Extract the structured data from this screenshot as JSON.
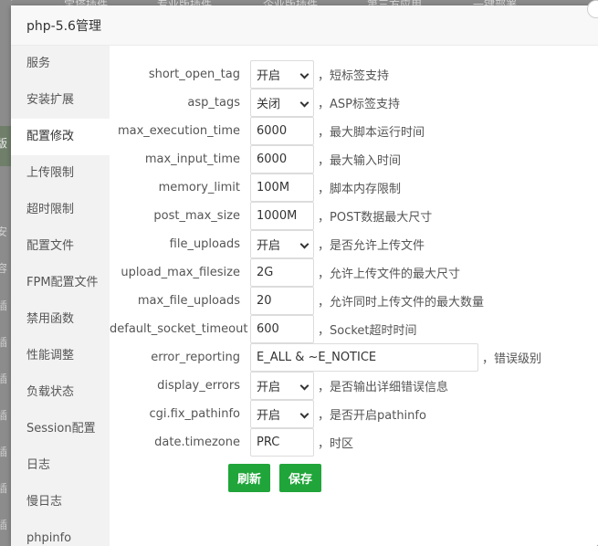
{
  "background": {
    "top_tabs": [
      "页",
      "宝塔插件",
      "专业版插件",
      "企业版插件",
      "第三方应用",
      "一键部署"
    ],
    "left_fragments": [
      "版",
      "安",
      "容",
      "插",
      "插",
      "插",
      "插",
      "插",
      "插",
      "插",
      "插",
      "插"
    ]
  },
  "dialog": {
    "title": "php-5.6管理"
  },
  "sidebar": {
    "items": [
      {
        "label": "服务"
      },
      {
        "label": "安装扩展"
      },
      {
        "label": "配置修改"
      },
      {
        "label": "上传限制"
      },
      {
        "label": "超时限制"
      },
      {
        "label": "配置文件"
      },
      {
        "label": "FPM配置文件"
      },
      {
        "label": "禁用函数"
      },
      {
        "label": "性能调整"
      },
      {
        "label": "负载状态"
      },
      {
        "label": "Session配置"
      },
      {
        "label": "日志"
      },
      {
        "label": "慢日志"
      },
      {
        "label": "phpinfo"
      }
    ],
    "active_index": 2
  },
  "form": {
    "rows": [
      {
        "label": "short_open_tag",
        "value": "开启",
        "type": "select",
        "hint": "，短标签支持"
      },
      {
        "label": "asp_tags",
        "value": "关闭",
        "type": "select",
        "hint": "，ASP标签支持"
      },
      {
        "label": "max_execution_time",
        "value": "6000",
        "type": "input",
        "hint": "，最大脚本运行时间"
      },
      {
        "label": "max_input_time",
        "value": "6000",
        "type": "input",
        "hint": "，最大输入时间"
      },
      {
        "label": "memory_limit",
        "value": "100M",
        "type": "input",
        "hint": "，脚本内存限制"
      },
      {
        "label": "post_max_size",
        "value": "1000M",
        "type": "input",
        "hint": "，POST数据最大尺寸"
      },
      {
        "label": "file_uploads",
        "value": "开启",
        "type": "select",
        "hint": "，是否允许上传文件"
      },
      {
        "label": "upload_max_filesize",
        "value": "2G",
        "type": "input",
        "hint": "，允许上传文件的最大尺寸"
      },
      {
        "label": "max_file_uploads",
        "value": "20",
        "type": "input",
        "hint": "，允许同时上传文件的最大数量"
      },
      {
        "label": "default_socket_timeout",
        "value": "600",
        "type": "input",
        "hint": "，Socket超时时间"
      },
      {
        "label": "error_reporting",
        "value": "E_ALL & ~E_NOTICE",
        "type": "input-wide",
        "hint": "，错误级别"
      },
      {
        "label": "display_errors",
        "value": "开启",
        "type": "select",
        "hint": "，是否输出详细错误信息"
      },
      {
        "label": "cgi.fix_pathinfo",
        "value": "开启",
        "type": "select",
        "hint": "，是否开启pathinfo"
      },
      {
        "label": "date.timezone",
        "value": "PRC",
        "type": "input",
        "hint": "，时区"
      }
    ],
    "refresh_label": "刷新",
    "save_label": "保存"
  },
  "colors": {
    "accent": "#20a53a",
    "sidebar_bg": "#f2f2f2",
    "overlay": "#7a7a7a"
  }
}
